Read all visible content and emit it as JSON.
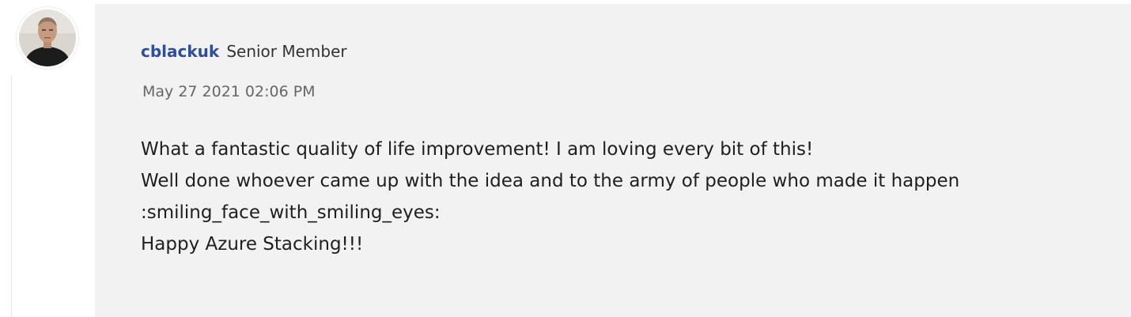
{
  "post": {
    "author": {
      "name": "cblackuk",
      "rank": "Senior Member",
      "avatar_icon": "user-avatar-photo"
    },
    "timestamp": "May 27 2021 02:06 PM",
    "body_lines": [
      "What a fantastic quality of life improvement! I am loving every bit of this!",
      "Well done whoever came up with the idea and to the army of people who made it happen",
      ":smiling_face_with_smiling_eyes:",
      "Happy Azure Stacking!!!"
    ]
  },
  "colors": {
    "bubble_background": "#f2f2f2",
    "author_link": "#2e4d9c",
    "timestamp_text": "#666666",
    "body_text": "#1f1f1f"
  }
}
